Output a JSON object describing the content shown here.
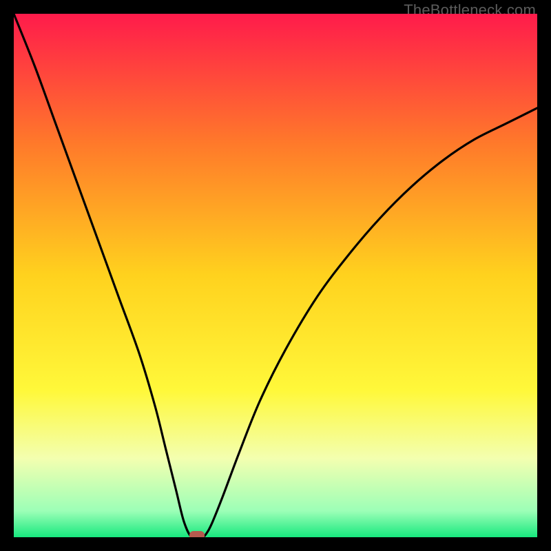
{
  "watermark": "TheBottleneck.com",
  "chart_data": {
    "type": "line",
    "title": "",
    "xlabel": "",
    "ylabel": "",
    "xlim": [
      0,
      100
    ],
    "ylim": [
      0,
      100
    ],
    "grid": false,
    "legend": false,
    "background_gradient_stops": [
      {
        "pct": 0,
        "color": "#ff1b4b"
      },
      {
        "pct": 25,
        "color": "#ff7a2a"
      },
      {
        "pct": 50,
        "color": "#ffd21e"
      },
      {
        "pct": 72,
        "color": "#fff83a"
      },
      {
        "pct": 85,
        "color": "#f3ffb0"
      },
      {
        "pct": 95,
        "color": "#9cffb7"
      },
      {
        "pct": 100,
        "color": "#17e87e"
      }
    ],
    "series": [
      {
        "name": "bottleneck-curve",
        "x": [
          0,
          4,
          8,
          12,
          16,
          20,
          24,
          27,
          29,
          31,
          32.5,
          34,
          36,
          37,
          38,
          40,
          43,
          47,
          52,
          58,
          64,
          70,
          76,
          82,
          88,
          94,
          100
        ],
        "y": [
          100,
          90,
          79,
          68,
          57,
          46,
          35,
          25,
          17,
          9,
          3,
          0,
          0,
          1,
          3,
          8,
          16,
          26,
          36,
          46,
          54,
          61,
          67,
          72,
          76,
          79,
          82
        ]
      }
    ],
    "marker": {
      "x": 35,
      "y": 0,
      "color": "#b55a4e"
    }
  }
}
